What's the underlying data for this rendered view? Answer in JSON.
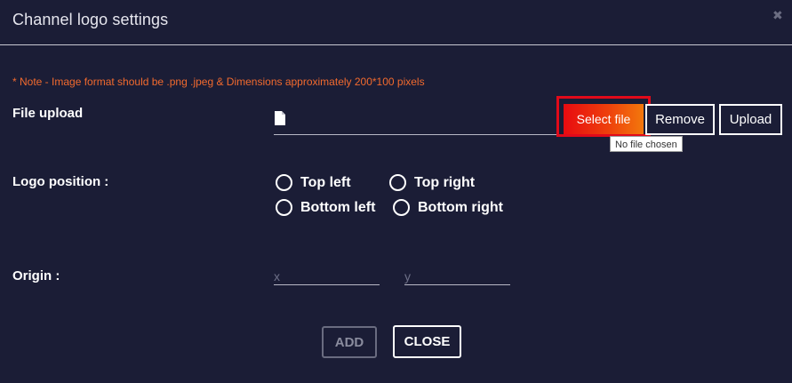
{
  "dialog": {
    "title": "Channel logo settings",
    "close_icon": "close-x-icon"
  },
  "note": "* Note - Image format should be .png .jpeg & Dimensions approximately 200*100 pixels",
  "file_upload": {
    "label": "File upload",
    "icon": "file-icon",
    "select_label": "Select file",
    "remove_label": "Remove",
    "upload_label": "Upload",
    "tooltip": "No file chosen"
  },
  "logo_position": {
    "label": "Logo position :",
    "options": [
      "Top left",
      "Top right",
      "Bottom left",
      "Bottom right"
    ]
  },
  "origin": {
    "label": "Origin :",
    "x_placeholder": "x",
    "y_placeholder": "y"
  },
  "footer": {
    "add_label": "ADD",
    "close_label": "CLOSE"
  },
  "colors": {
    "background": "#1b1d36",
    "note": "#f26a2e",
    "highlight_border": "#e10a1a",
    "select_gradient_start": "#e80b10",
    "select_gradient_end": "#f3780c"
  }
}
